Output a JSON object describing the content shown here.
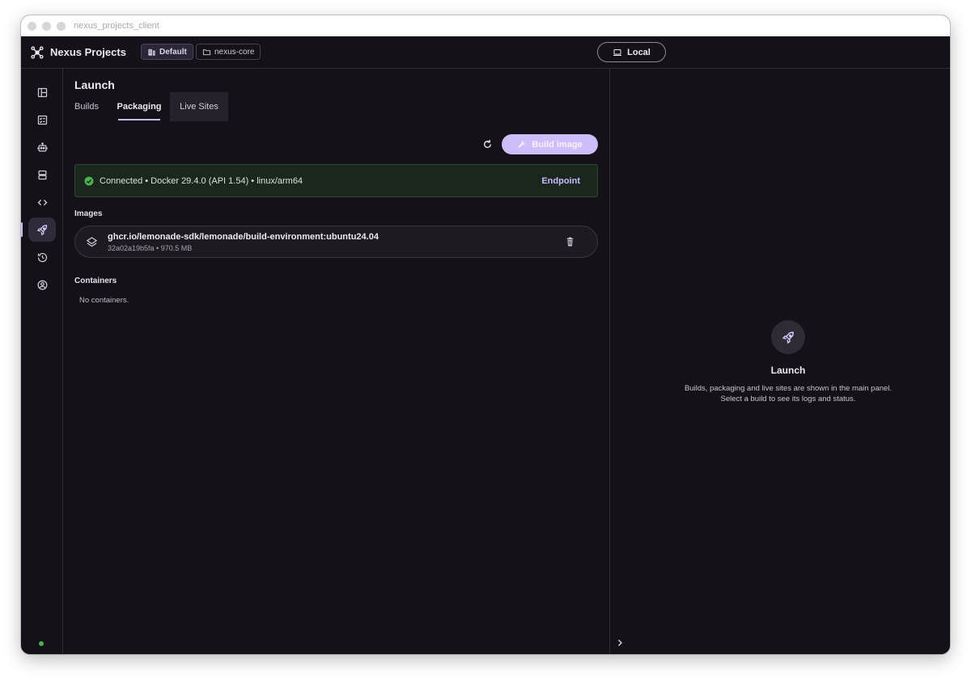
{
  "window": {
    "title": "nexus_projects_client"
  },
  "header": {
    "app_name": "Nexus Projects",
    "workspace_chip": "Default",
    "project_chip": "nexus-core",
    "environment_button": "Local"
  },
  "sidebar": {
    "items": [
      {
        "icon": "layout-icon",
        "active": false
      },
      {
        "icon": "checklist-icon",
        "active": false
      },
      {
        "icon": "robot-icon",
        "active": false
      },
      {
        "icon": "server-icon",
        "active": false
      },
      {
        "icon": "code-icon",
        "active": false
      },
      {
        "icon": "rocket-icon",
        "active": true
      },
      {
        "icon": "history-icon",
        "active": false
      },
      {
        "icon": "account-icon",
        "active": false
      }
    ],
    "status_color": "#4caf50"
  },
  "main": {
    "title": "Launch",
    "tabs": [
      {
        "label": "Builds",
        "active": false
      },
      {
        "label": "Packaging",
        "active": true
      },
      {
        "label": "Live Sites",
        "active": false
      }
    ],
    "build_button": "Build image",
    "connection": {
      "status_text": "Connected • Docker 29.4.0 (API 1.54) • linux/arm64",
      "endpoint_link": "Endpoint"
    },
    "images_label": "Images",
    "images": [
      {
        "name": "ghcr.io/lemonade-sdk/lemonade/build-environment:ubuntu24.04",
        "meta": "32a02a19b5fa • 970.5 MB"
      }
    ],
    "containers_label": "Containers",
    "containers_empty": "No containers."
  },
  "right_panel": {
    "title": "Launch",
    "description": "Builds, packaging and live sites are shown in the main panel. Select a build to see its logs and status."
  },
  "colors": {
    "accent": "#c9b9ff",
    "button": "#cdbdf8",
    "success": "#4caf50",
    "background": "#141218"
  }
}
